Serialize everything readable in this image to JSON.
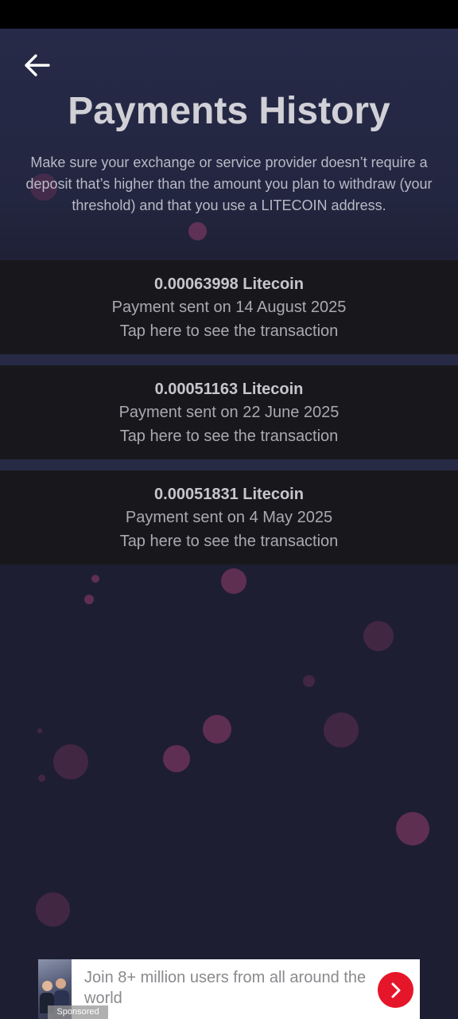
{
  "header": {
    "title": "Payments History",
    "notice": "Make sure your exchange or service provider doesn’t require a deposit that’s higher than the amount you plan to withdraw (your threshold) and that you use a LITECOIN address."
  },
  "icons": {
    "back": "arrow-left-icon",
    "ad_cta": "chevron-right-icon"
  },
  "payments": [
    {
      "amount": "0.00063998 Litecoin",
      "date_line": "Payment sent on 14 August 2025",
      "link_text": "Tap here to see the transaction"
    },
    {
      "amount": "0.00051163 Litecoin",
      "date_line": "Payment sent on 22 June 2025",
      "link_text": "Tap here to see the transaction"
    },
    {
      "amount": "0.00051831 Litecoin",
      "date_line": "Payment sent on 4 May 2025",
      "link_text": "Tap here to see the transaction"
    }
  ],
  "ad": {
    "headline": "Join 8+ million users from all around the world",
    "sponsored_label": "Sponsored"
  },
  "colors": {
    "background": "#1e1e32",
    "card": "#18181c",
    "bubble": "#963e6e",
    "ad_cta": "#e6162a"
  }
}
